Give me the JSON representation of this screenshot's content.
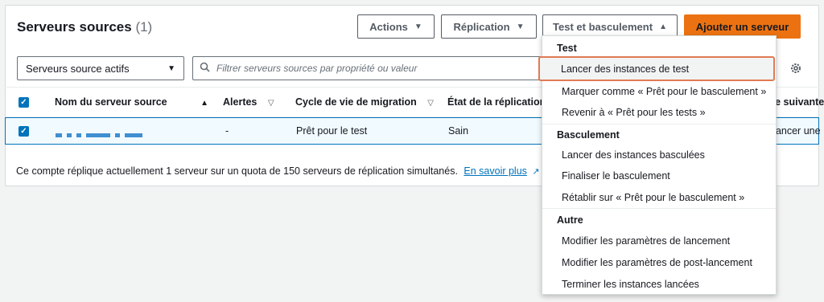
{
  "header": {
    "title": "Serveurs sources",
    "count": "(1)",
    "actions_label": "Actions",
    "replication_label": "Réplication",
    "test_label": "Test et basculement",
    "add_label": "Ajouter un serveur"
  },
  "filter": {
    "status_select": "Serveurs source actifs",
    "search_placeholder": "Filtrer serveurs sources par propriété ou valeur"
  },
  "table": {
    "columns": [
      "Nom du serveur source",
      "Alertes",
      "Cycle de vie de migration",
      "État de la réplication",
      "Étape suivante"
    ],
    "row": {
      "alerts": "-",
      "lifecycle": "Prêt pour le test",
      "replication_state": "Sain",
      "next_step": "Lancer une"
    }
  },
  "footer": {
    "text": "Ce compte réplique actuellement 1 serveur sur un quota de 150 serveurs de réplication simultanés.",
    "link": "En savoir plus"
  },
  "menu": {
    "group_test": "Test",
    "launch_test": "Lancer des instances de test",
    "mark_ready_cutover": "Marquer comme « Prêt pour le basculement »",
    "revert_ready_testing": "Revenir à « Prêt pour les tests »",
    "group_cutover": "Basculement",
    "launch_cutover": "Lancer des instances basculées",
    "finalize_cutover": "Finaliser le basculement",
    "revert_ready_cutover": "Rétablir sur « Prêt pour le basculement »",
    "group_other": "Autre",
    "edit_launch": "Modifier les paramètres de lancement",
    "edit_post_launch": "Modifier les paramètres de post-lancement",
    "terminate": "Terminer les instances lancées"
  },
  "colors": {
    "primary": "#ec7211",
    "link": "#0073bb",
    "highlight": "#e07b53"
  }
}
